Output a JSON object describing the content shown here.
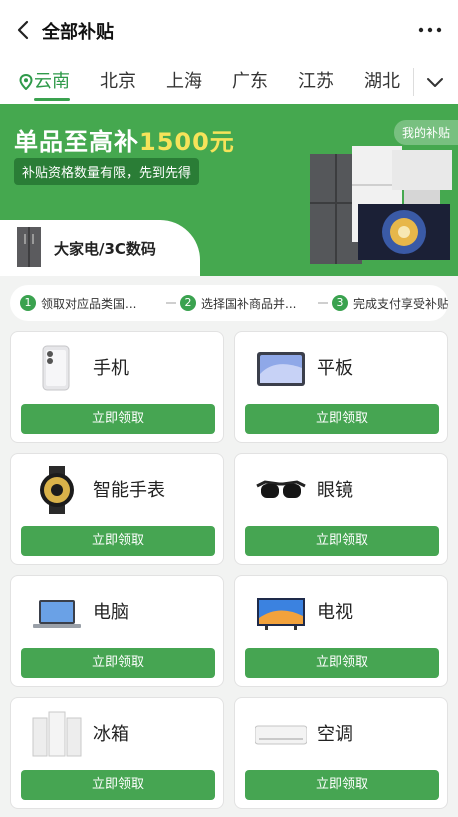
{
  "header": {
    "title": "全部补贴"
  },
  "tabs": {
    "items": [
      {
        "label": "云南"
      },
      {
        "label": "北京"
      },
      {
        "label": "上海"
      },
      {
        "label": "广东"
      },
      {
        "label": "江苏"
      },
      {
        "label": "湖北"
      }
    ]
  },
  "banner": {
    "headline_prefix": "单品至高补",
    "headline_amount": "1500元",
    "subtitle": "补贴资格数量有限，先到先得",
    "my_subsidy": "我的补贴",
    "category": "大家电/3C数码"
  },
  "steps": [
    {
      "num": "1",
      "text": "领取对应品类国..."
    },
    {
      "num": "2",
      "text": "选择国补商品并..."
    },
    {
      "num": "3",
      "text": "完成支付享受补贴"
    }
  ],
  "products": [
    {
      "name": "手机",
      "button": "立即领取"
    },
    {
      "name": "平板",
      "button": "立即领取"
    },
    {
      "name": "智能手表",
      "button": "立即领取"
    },
    {
      "name": "眼镜",
      "button": "立即领取"
    },
    {
      "name": "电脑",
      "button": "立即领取"
    },
    {
      "name": "电视",
      "button": "立即领取"
    },
    {
      "name": "冰箱",
      "button": "立即领取"
    },
    {
      "name": "空调",
      "button": "立即领取"
    }
  ],
  "colors": {
    "brand_green": "#45a84f",
    "highlight_yellow": "#f6e35a"
  }
}
